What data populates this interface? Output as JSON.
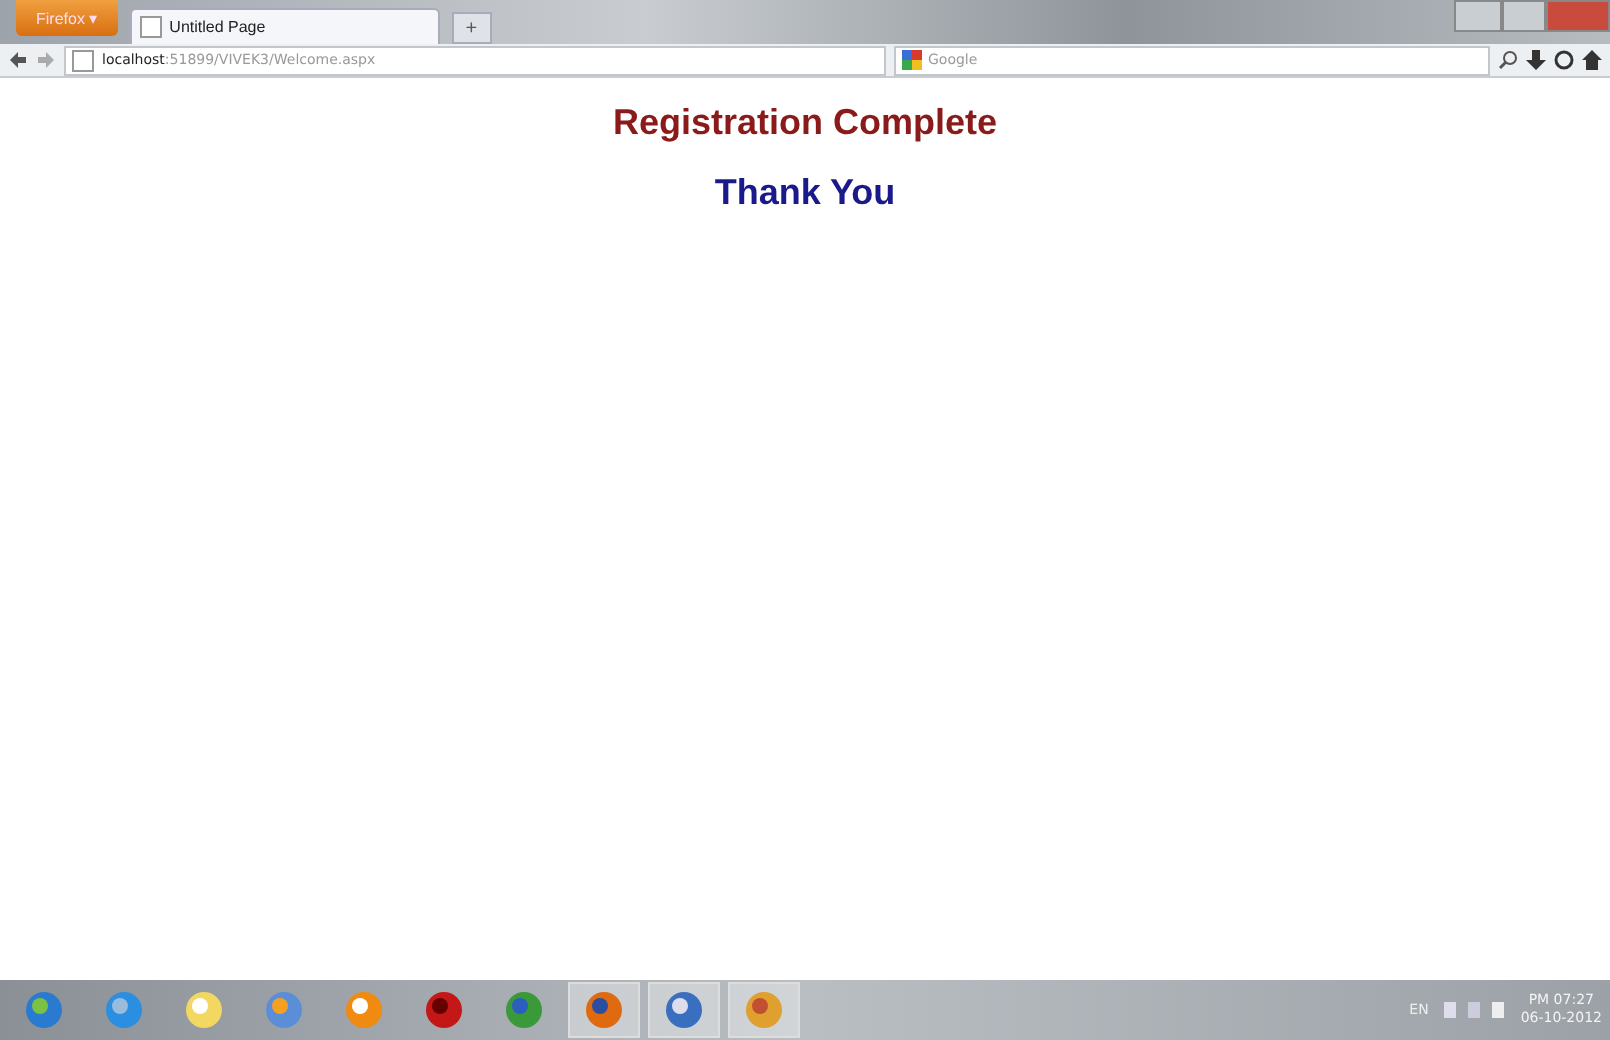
{
  "browser": {
    "menu_button": "Firefox ▾",
    "tabs": [
      {
        "label": "Untitled Page",
        "selected": true
      }
    ],
    "new_tab": "+",
    "url_host": "localhost",
    "url_rest": ":51899/VIVEK3/Welcome.aspx",
    "search_placeholder": "Google"
  },
  "page": {
    "heading": "Registration Complete",
    "subheading": "Thank You"
  },
  "taskbar": {
    "items": [
      {
        "kind": "start",
        "selected": false
      },
      {
        "kind": "ie",
        "selected": false
      },
      {
        "kind": "notes",
        "selected": false
      },
      {
        "kind": "media",
        "selected": false
      },
      {
        "kind": "cone",
        "selected": false
      },
      {
        "kind": "red",
        "selected": false
      },
      {
        "kind": "globe",
        "selected": false
      },
      {
        "kind": "firefox",
        "selected": true
      },
      {
        "kind": "doc",
        "selected": true
      },
      {
        "kind": "app",
        "selected": true
      }
    ],
    "language": "EN",
    "time": "PM 07:27",
    "date": "06-10-2012"
  }
}
